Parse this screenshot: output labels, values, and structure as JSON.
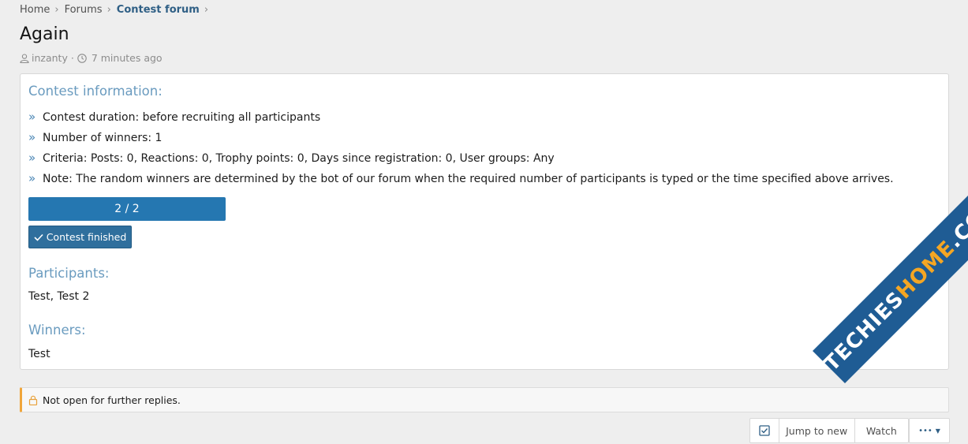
{
  "breadcrumb": {
    "home": "Home",
    "forums": "Forums",
    "current": "Contest forum"
  },
  "thread": {
    "title": "Again",
    "author": "inzanty",
    "separator": "·",
    "time": "7 minutes ago"
  },
  "contest": {
    "info_heading": "Contest information:",
    "info_items": [
      "Contest duration: before recruiting all participants",
      "Number of winners: 1",
      "Criteria: Posts: 0, Reactions: 0, Trophy points: 0, Days since registration: 0, User groups: Any",
      "Note: The random winners are determined by the bot of our forum when the required number of participants is typed or the time specified above arrives."
    ],
    "progress_label": "2 / 2",
    "progress_fraction": 1.0,
    "status_button": "Contest finished",
    "participants_heading": "Participants:",
    "participants": "Test, Test 2",
    "winners_heading": "Winners:",
    "winners": "Test"
  },
  "notice": {
    "text": "Not open for further replies."
  },
  "actions": {
    "jump_label": "Jump to new",
    "watch_label": "Watch",
    "more_label": "•••"
  },
  "watermark": {
    "part1": "TECHIES",
    "part2": "HOME",
    "part3": ".COM"
  },
  "colors": {
    "accent": "#2577b1",
    "heading": "#6a9bbf",
    "notice_border": "#f0a53a"
  }
}
